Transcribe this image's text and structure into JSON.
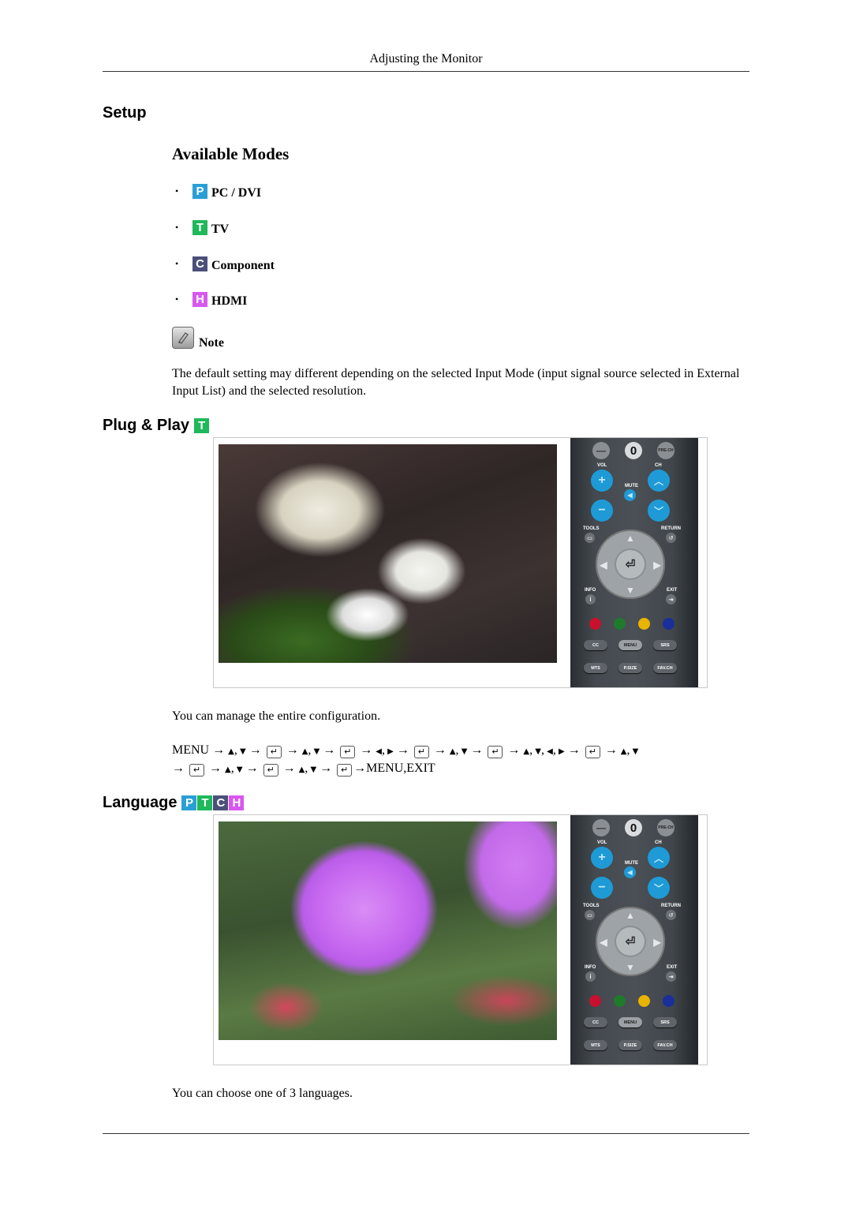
{
  "header": {
    "running_title": "Adjusting the Monitor"
  },
  "section": {
    "title": "Setup"
  },
  "available_modes": {
    "title": "Available Modes",
    "bullet": "•",
    "items": [
      {
        "icon_letter": "P",
        "icon": "pc-dvi-mode-icon",
        "color": "#2a9fd6",
        "label": "PC / DVI"
      },
      {
        "icon_letter": "T",
        "icon": "tv-mode-icon",
        "color": "#1fb85a",
        "label": "TV"
      },
      {
        "icon_letter": "C",
        "icon": "component-mode-icon",
        "color": "#4b4f7a",
        "label": "Component"
      },
      {
        "icon_letter": "H",
        "icon": "hdmi-mode-icon",
        "color": "#d857ef",
        "label": "HDMI"
      }
    ]
  },
  "note": {
    "label": "Note",
    "text": "The default setting may different depending on the selected Input Mode (input signal source selected in External Input List) and the selected resolution."
  },
  "plug_and_play": {
    "title": "Plug & Play",
    "mode_icons": [
      "T"
    ],
    "caption": "You can manage the entire configuration.",
    "sequence_line1": [
      "MENU",
      "→",
      "▲",
      ",",
      "▼",
      "→",
      "ENTER",
      "→",
      "▲",
      ",",
      "▼",
      "→",
      "ENTER",
      "→",
      "◀",
      ",",
      "▶",
      "→",
      "ENTER",
      "→",
      "▲",
      ",",
      "▼",
      "→",
      "ENTER",
      "→",
      "▲",
      ",",
      "▼",
      ",",
      "◀",
      ",",
      "▶",
      "→",
      "ENTER",
      "→",
      "▲",
      ",",
      "▼"
    ],
    "sequence_line2": [
      "→",
      "ENTER",
      "→",
      "▲",
      ",",
      "▼",
      "→",
      "ENTER",
      "→",
      "▲",
      ",",
      "▼",
      "→",
      "ENTER",
      "→MENU,EXIT"
    ]
  },
  "language": {
    "title": "Language",
    "mode_icons": [
      "P",
      "T",
      "C",
      "H"
    ],
    "caption": "You can choose one of 3 languages."
  },
  "remote": {
    "top_buttons": [
      "—",
      "0",
      "PRE-CH"
    ],
    "labels": {
      "vol": "VOL",
      "ch": "CH",
      "mute": "MUTE",
      "tools": "TOOLS",
      "return": "RETURN",
      "info": "INFO",
      "exit": "EXIT"
    },
    "color_buttons": [
      "#c8102e",
      "#1f7a2c",
      "#e8b400",
      "#1a2f9a"
    ],
    "row1": [
      "CC",
      "MENU",
      "SRS"
    ],
    "row2": [
      "MTS",
      "P.SIZE",
      "FAV.CH"
    ],
    "accent": "#1e9ad6"
  }
}
